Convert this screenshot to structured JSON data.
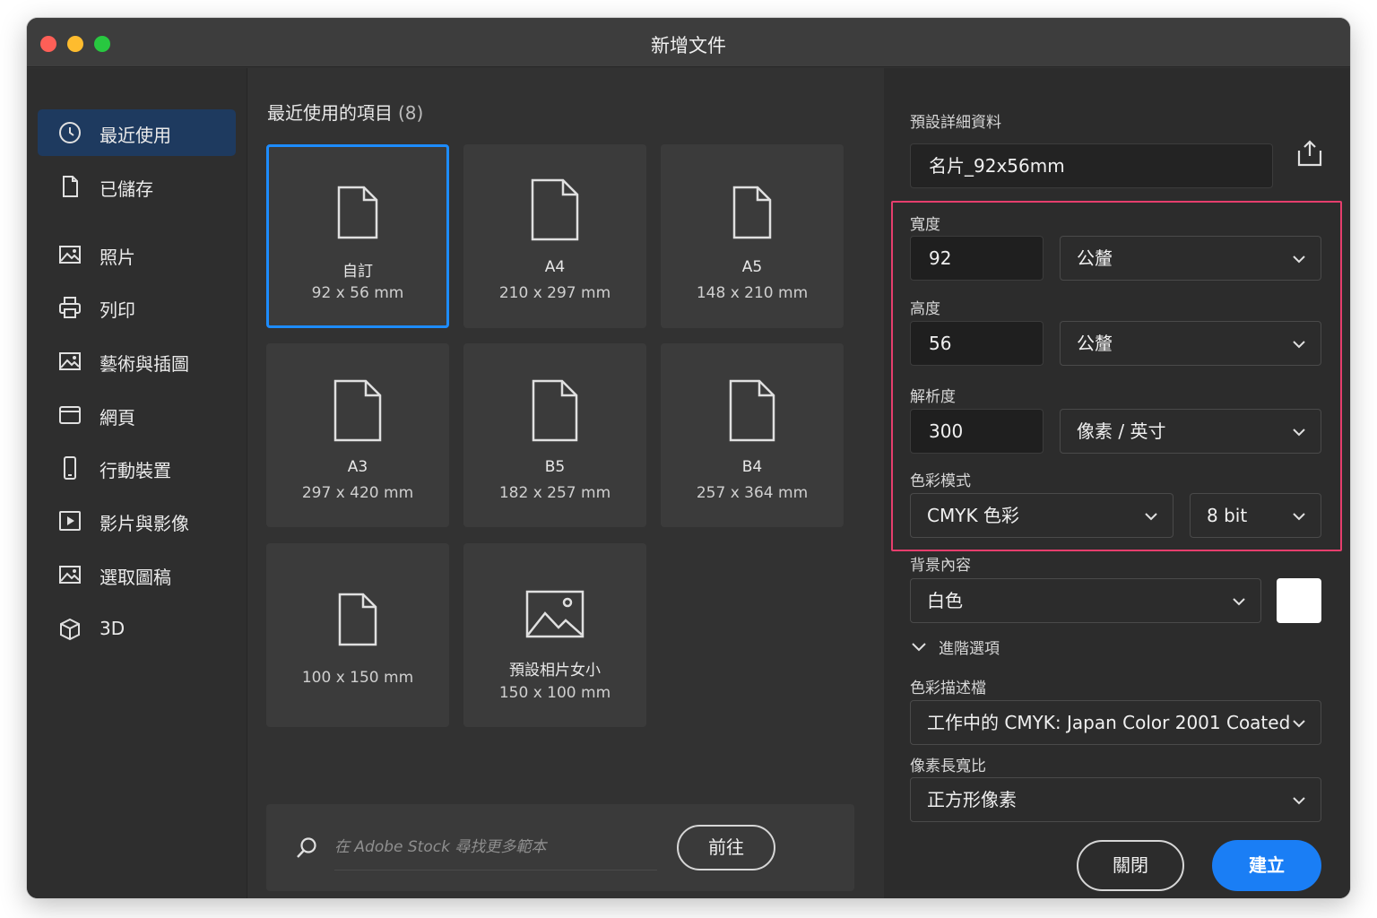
{
  "window": {
    "title": "新增文件"
  },
  "sidebar": {
    "items": [
      {
        "label": "最近使用",
        "icon": "clock-icon",
        "active": true
      },
      {
        "label": "已儲存",
        "icon": "document-icon"
      },
      {
        "label": "照片",
        "icon": "image-icon"
      },
      {
        "label": "列印",
        "icon": "printer-icon"
      },
      {
        "label": "藝術與插圖",
        "icon": "image-icon"
      },
      {
        "label": "網頁",
        "icon": "browser-icon"
      },
      {
        "label": "行動裝置",
        "icon": "phone-icon"
      },
      {
        "label": "影片與影像",
        "icon": "video-icon"
      },
      {
        "label": "選取圖稿",
        "icon": "image-icon"
      },
      {
        "label": "3D",
        "icon": "cube-icon"
      }
    ]
  },
  "recent": {
    "title": "最近使用的項目",
    "count": "(8)",
    "presets": [
      {
        "name": "自訂",
        "size": "92 x 56 mm",
        "icon": "document-icon",
        "selected": true
      },
      {
        "name": "A4",
        "size": "210 x 297 mm",
        "icon": "document-icon"
      },
      {
        "name": "A5",
        "size": "148 x 210 mm",
        "icon": "document-icon"
      },
      {
        "name": "A3",
        "size": "297 x 420 mm",
        "icon": "document-icon"
      },
      {
        "name": "B5",
        "size": "182 x 257 mm",
        "icon": "document-icon"
      },
      {
        "name": "B4",
        "size": "257 x 364 mm",
        "icon": "document-icon"
      },
      {
        "name": "",
        "size": "100 x 150 mm",
        "icon": "document-icon"
      },
      {
        "name": "預設相片女小",
        "size": "150 x 100 mm",
        "icon": "image-icon"
      }
    ]
  },
  "stock": {
    "placeholder": "在 Adobe Stock 尋找更多範本",
    "go_label": "前往",
    "icon": "search-icon"
  },
  "details": {
    "section_label": "預設詳細資料",
    "preset_name": "名片_92x56mm",
    "width_label": "寬度",
    "width_value": "92",
    "width_unit": "公釐",
    "height_label": "高度",
    "height_value": "56",
    "height_unit": "公釐",
    "resolution_label": "解析度",
    "resolution_value": "300",
    "resolution_unit": "像素 / 英寸",
    "color_mode_label": "色彩模式",
    "color_mode": "CMYK 色彩",
    "bit_depth": "8 bit",
    "background_label": "背景內容",
    "background_value": "白色",
    "background_swatch": "#ffffff",
    "advanced_label": "進階選項",
    "color_profile_label": "色彩描述檔",
    "color_profile": "工作中的 CMYK: Japan Color 2001 Coated",
    "pixel_aspect_label": "像素長寬比",
    "pixel_aspect": "正方形像素",
    "close_label": "關閉",
    "create_label": "建立"
  },
  "colors": {
    "accent": "#1a7ef5",
    "selection": "#1d8cff",
    "highlight": "#e63e6d"
  }
}
